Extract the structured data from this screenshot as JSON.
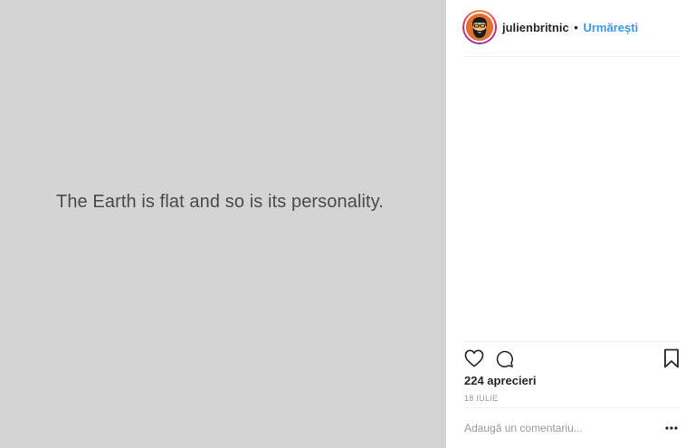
{
  "post": {
    "media_text": "The Earth is flat and so is its personality."
  },
  "header": {
    "username": "julienbritnic",
    "separator": "•",
    "follow_label": "Urmărești"
  },
  "actions": {
    "like_icon": "heart-outline",
    "comment_icon": "speech-bubble",
    "save_icon": "bookmark-outline"
  },
  "likes": {
    "text": "224 aprecieri"
  },
  "date": {
    "text": "18 IULIE"
  },
  "comment": {
    "placeholder": "Adaugă un comentariu...",
    "more_icon": "ellipsis"
  },
  "colors": {
    "media_bg": "#d4d4d4",
    "follow": "#3897f0",
    "text": "#262626",
    "muted": "#999999"
  }
}
